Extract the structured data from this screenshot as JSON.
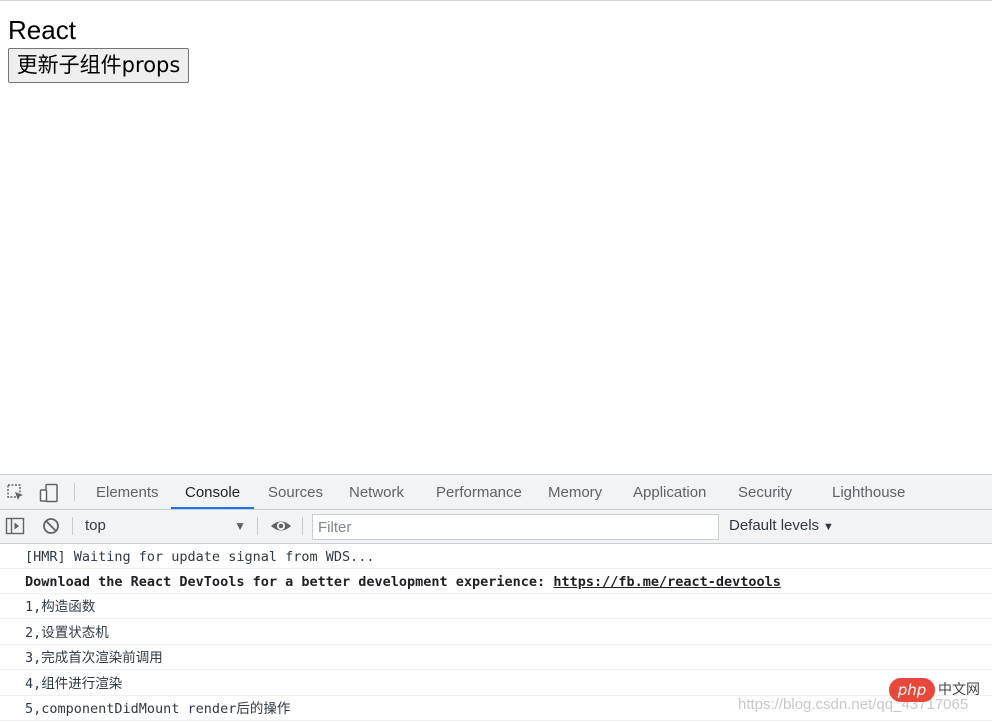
{
  "app": {
    "title": "React",
    "update_button_label": "更新子组件props"
  },
  "devtools": {
    "tabs": [
      {
        "label": "Elements"
      },
      {
        "label": "Console"
      },
      {
        "label": "Sources"
      },
      {
        "label": "Network"
      },
      {
        "label": "Performance"
      },
      {
        "label": "Memory"
      },
      {
        "label": "Application"
      },
      {
        "label": "Security"
      },
      {
        "label": "Lighthouse"
      }
    ],
    "active_tab": "Console",
    "accent_color": "#1a73e8",
    "toolbar_icons": [
      "inspect-element-icon",
      "device-toggle-icon"
    ],
    "console_toolbar": {
      "sidebar_icon": "sidebar-toggle-icon",
      "clear_icon": "clear-console-icon",
      "context_value": "top",
      "live_expression_icon": "eye-icon",
      "filter_placeholder": "Filter",
      "levels_label": "Default levels"
    },
    "messages": [
      {
        "text": "[HMR] Waiting for update signal from WDS..."
      },
      {
        "text": "Download the React DevTools for a better development experience: ",
        "link": "https://fb.me/react-devtools"
      },
      {
        "text": "1,构造函数"
      },
      {
        "text": "2,设置状态机"
      },
      {
        "text": "3,完成首次渲染前调用"
      },
      {
        "text": "4,组件进行渲染"
      },
      {
        "text": "5,componentDidMount render后的操作"
      }
    ]
  },
  "watermark": {
    "url_text": "https://blog.csdn.net/qq_43717065",
    "badge_text": "php",
    "badge_cn": "中文网",
    "badge_color": "#e9473a"
  }
}
